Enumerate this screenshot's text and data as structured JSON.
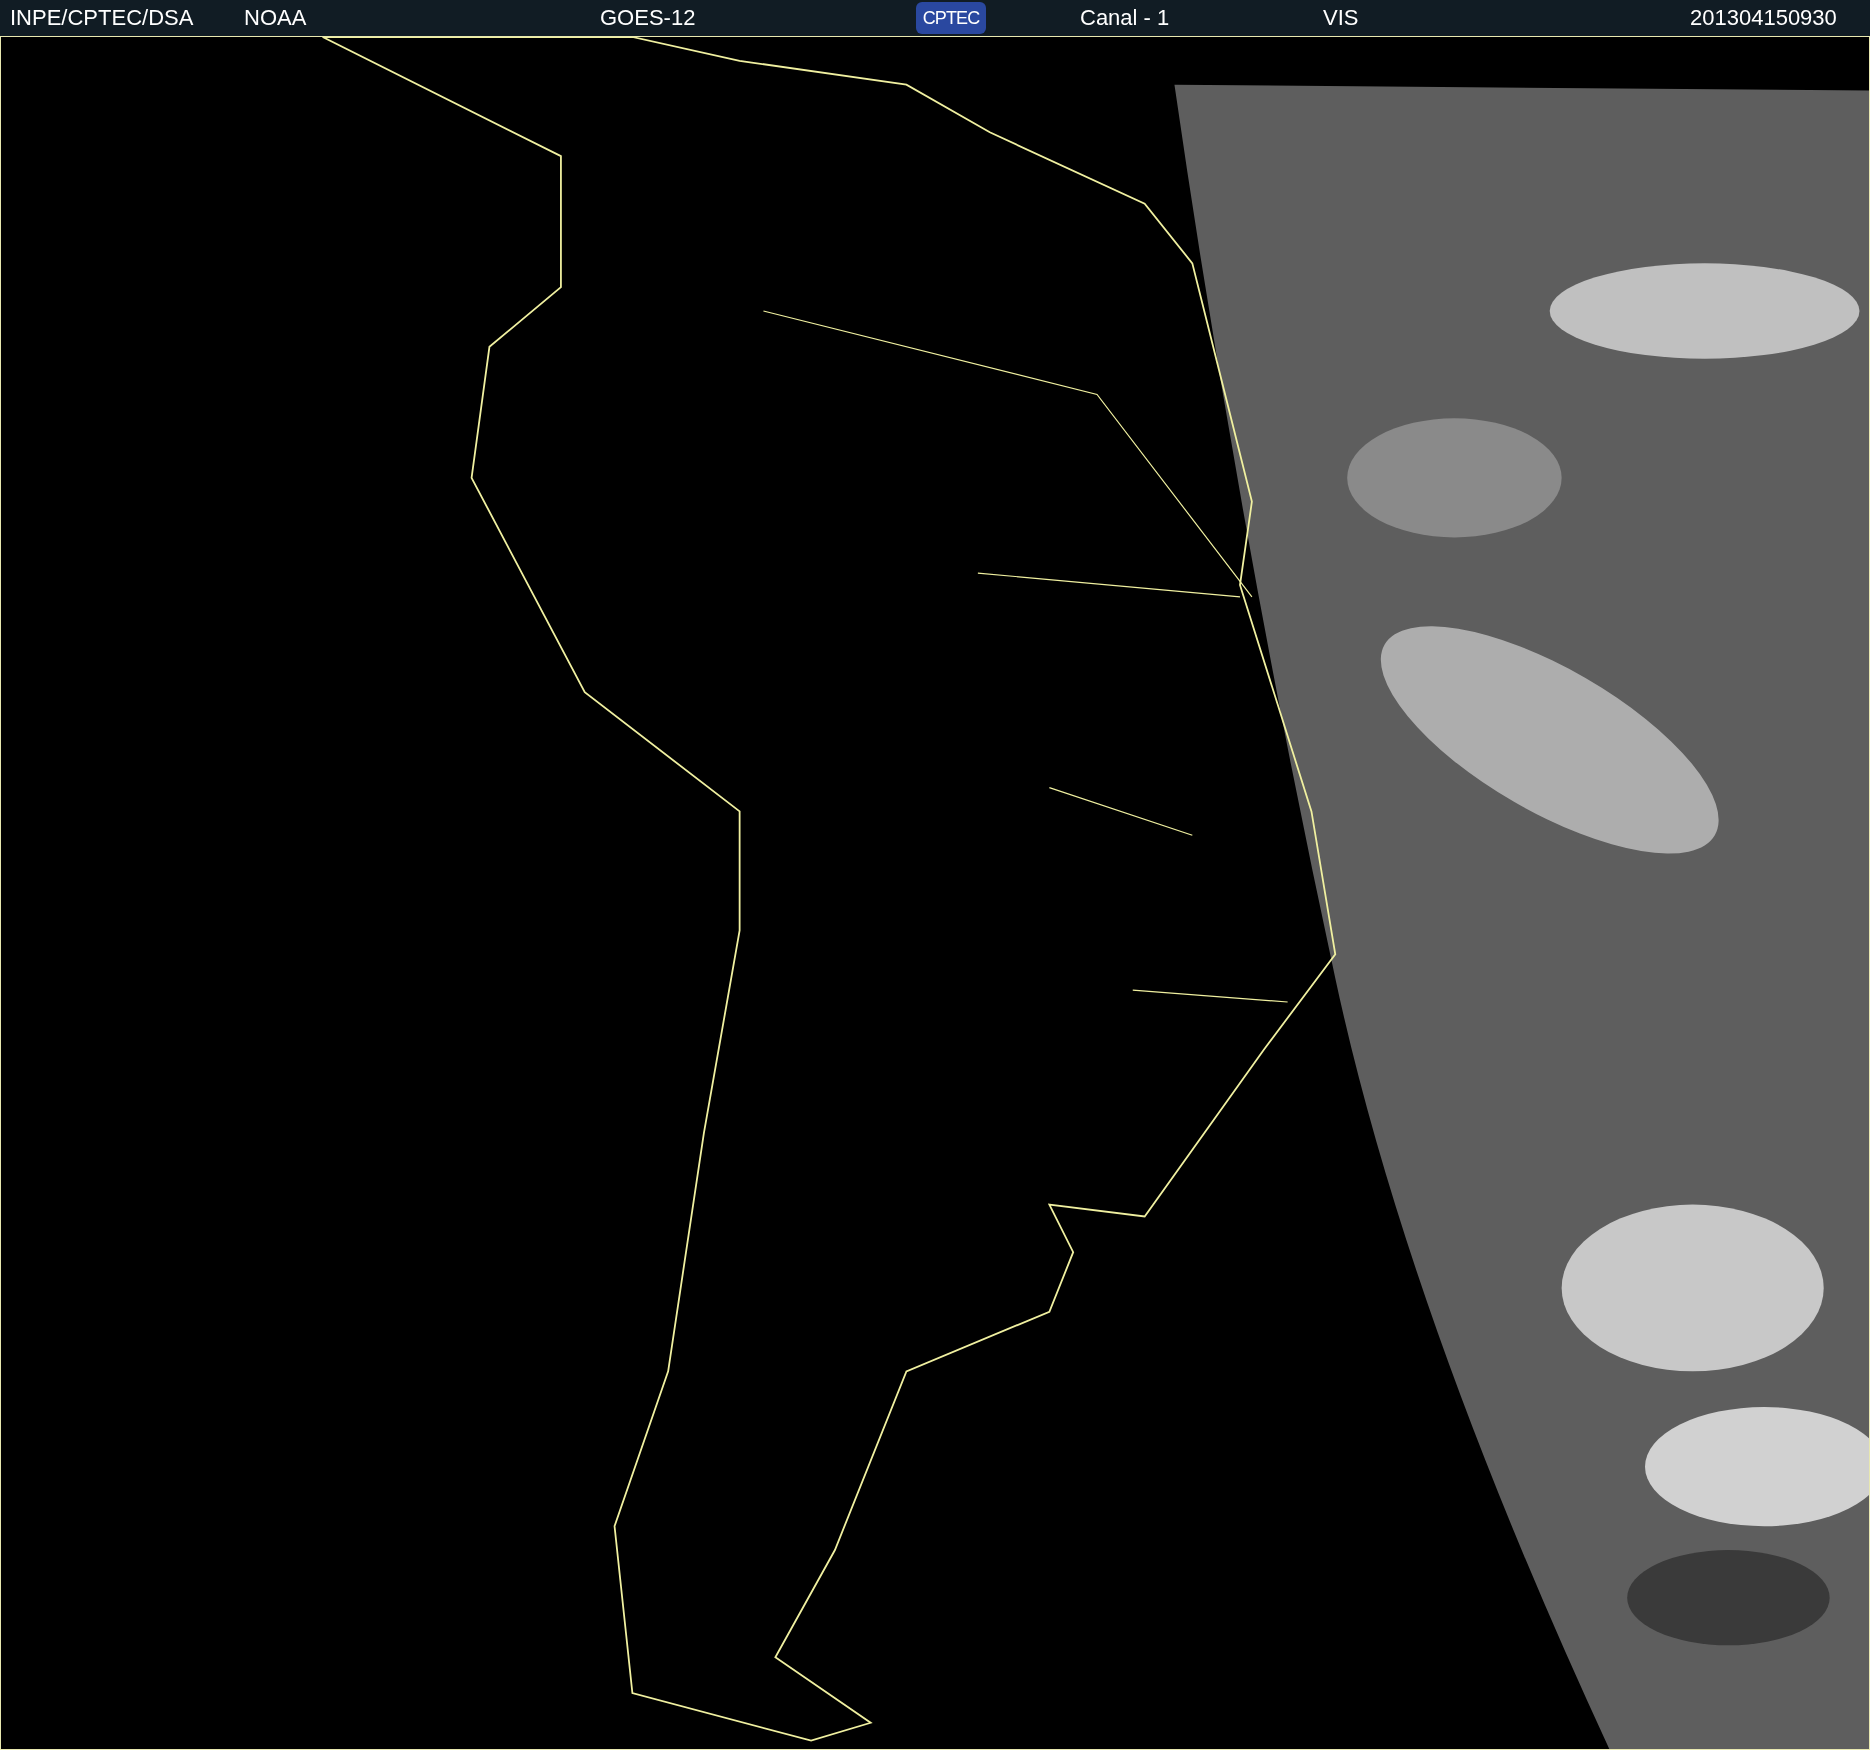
{
  "header": {
    "items": [
      {
        "kind": "text",
        "text": "INPE/CPTEC/DSA"
      },
      {
        "kind": "text",
        "text": "NOAA"
      },
      {
        "kind": "text",
        "text": "GOES-12"
      },
      {
        "kind": "logo",
        "text": "CPTEC"
      },
      {
        "kind": "text",
        "text": "Canal - 1"
      },
      {
        "kind": "text",
        "text": "VIS"
      },
      {
        "kind": "text",
        "text": "201304150930"
      }
    ]
  }
}
